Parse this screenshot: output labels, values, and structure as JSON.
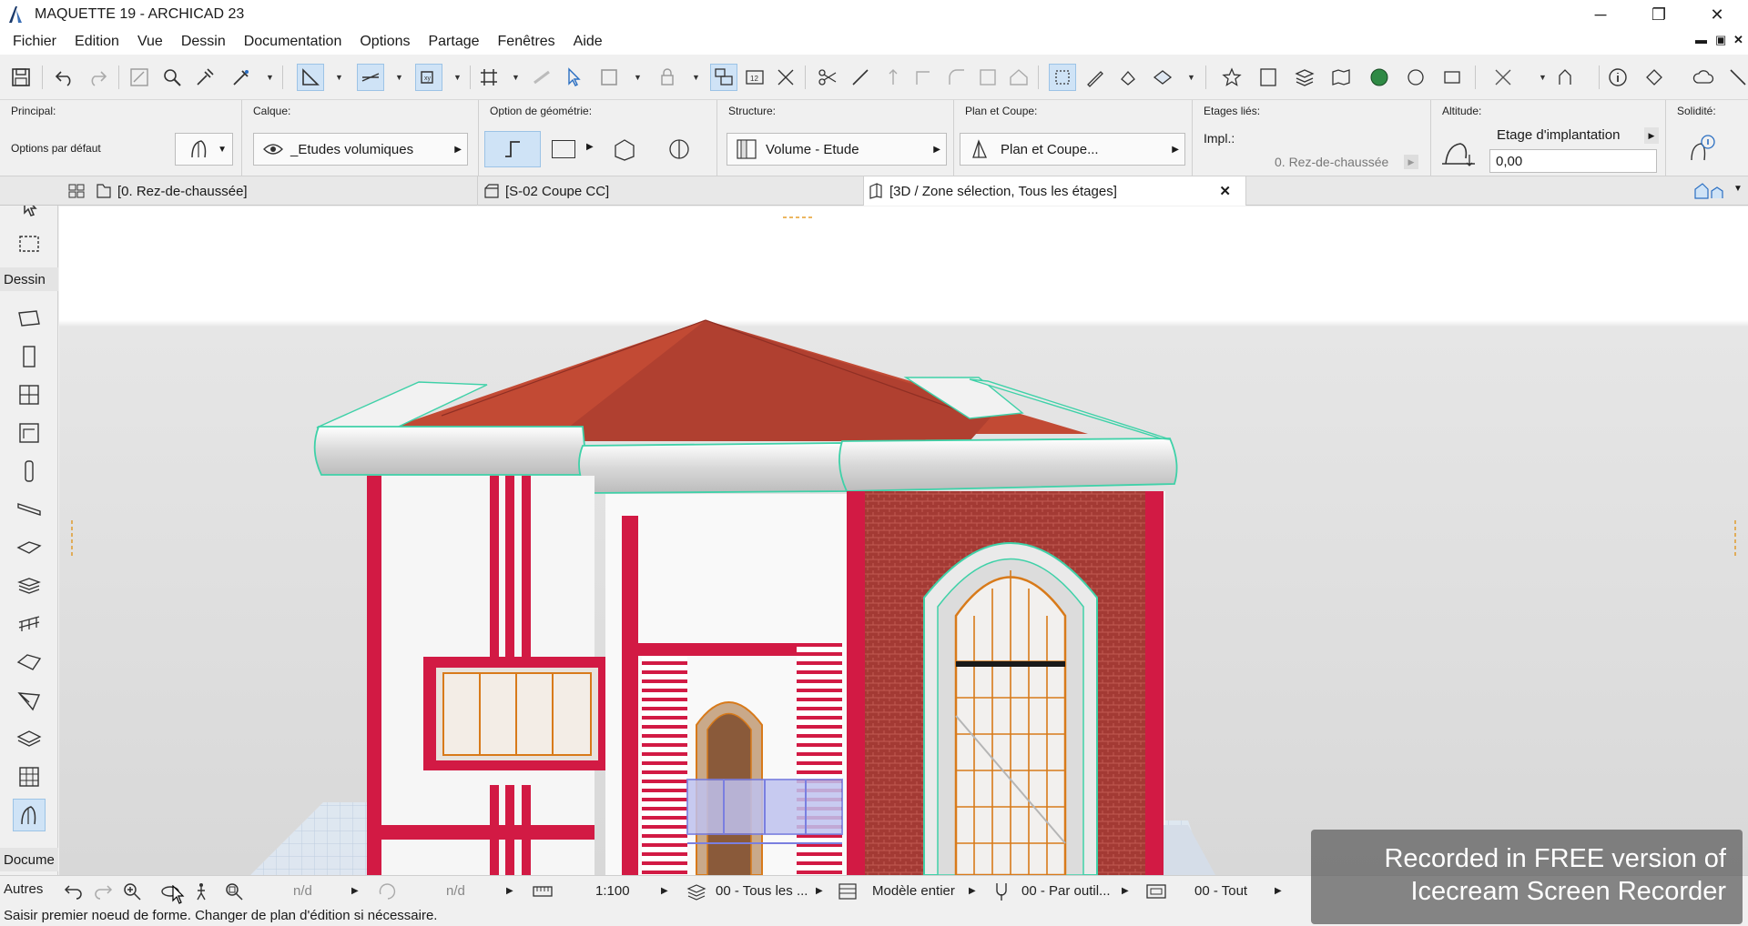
{
  "window": {
    "title": "MAQUETTE 19 - ARCHICAD 23"
  },
  "menu": [
    "Fichier",
    "Edition",
    "Vue",
    "Dessin",
    "Documentation",
    "Options",
    "Partage",
    "Fenêtres",
    "Aide"
  ],
  "infobox": {
    "principal_label": "Principal:",
    "principal_value": "Options par défaut",
    "calque_label": "Calque:",
    "calque_value": "_Etudes volumiques",
    "geometry_label": "Option de géométrie:",
    "structure_label": "Structure:",
    "structure_value": "Volume - Etude",
    "plan_label": "Plan et Coupe:",
    "plan_value": "Plan et Coupe...",
    "etages_label": "Etages liés:",
    "impl_label": "Impl.:",
    "impl_value": "0. Rez-de-chaussée",
    "altitude_label": "Altitude:",
    "altitude_ref": "Etage d'implantation",
    "altitude_value": "0,00",
    "solidite_label": "Solidité:"
  },
  "tabs": [
    {
      "label": "[0. Rez-de-chaussée]"
    },
    {
      "label": "[S-02 Coupe CC]"
    },
    {
      "label": "[3D / Zone sélection, Tous les étages]"
    }
  ],
  "toolbox": {
    "dessin_label": "Dessin",
    "docume_label": "Docume",
    "autres_label": "Autres"
  },
  "status": {
    "nd1": "n/d",
    "nd2": "n/d",
    "scale": "1:100",
    "layers": "00 - Tous les ...",
    "model": "Modèle entier",
    "pen": "00 - Par outil...",
    "all": "00 - Tout"
  },
  "hint": "Saisir premier noeud de forme. Changer de plan d'édition si nécessaire.",
  "watermark": {
    "line1": "Recorded in FREE version of",
    "line2": "Icecream Screen Recorder"
  },
  "colors": {
    "roof": "#c24a34",
    "walls_red": "#d21a44",
    "trim_green": "#3fd1a8",
    "active_tool": "#cfe3f6"
  }
}
